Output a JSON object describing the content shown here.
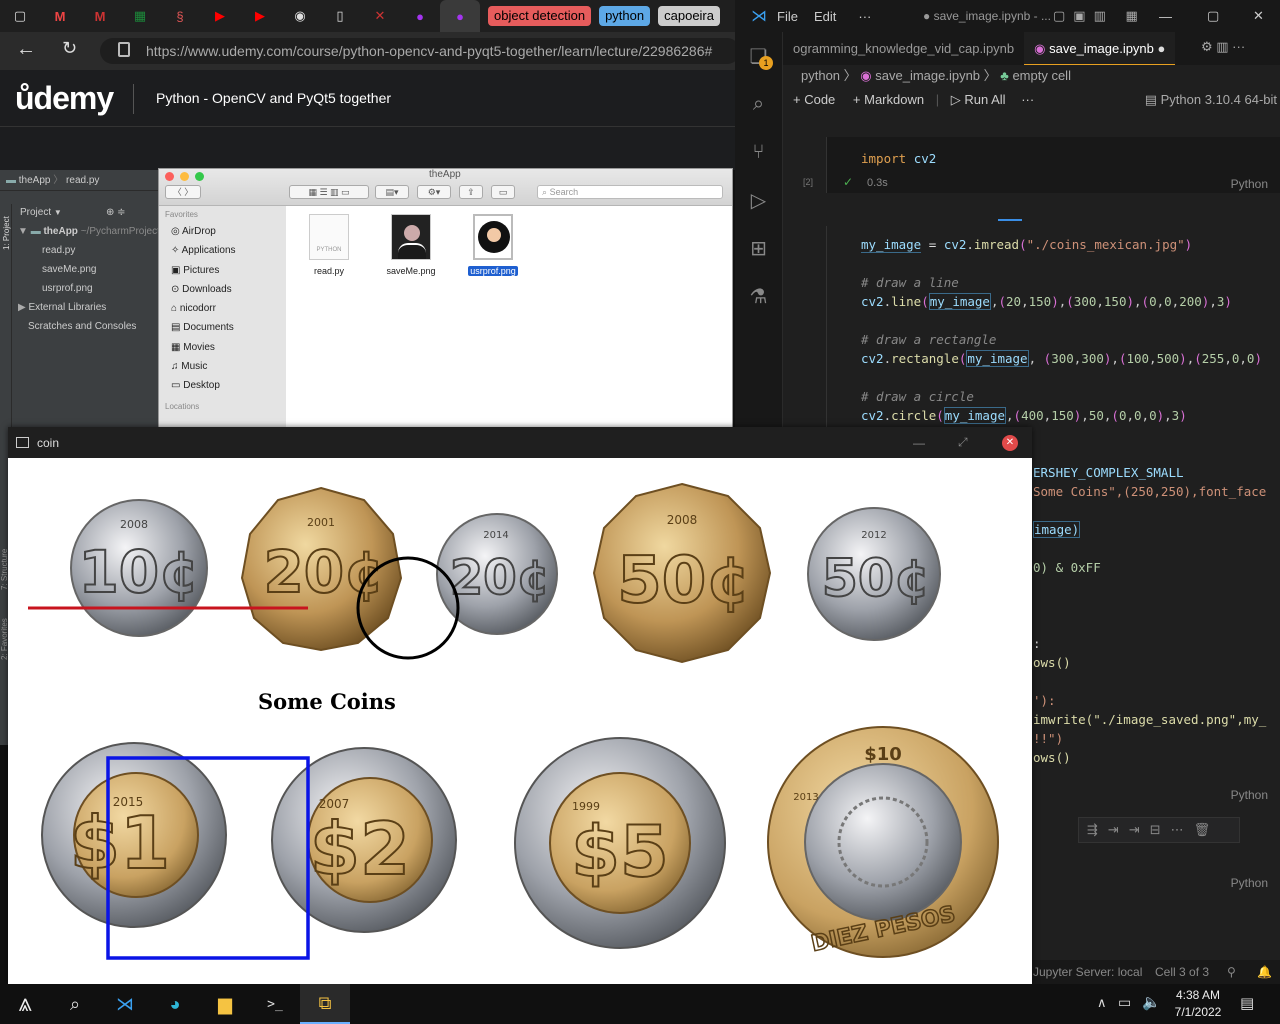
{
  "browser": {
    "bookmarks": [
      {
        "label": "object detection",
        "color": "#e65c5c"
      },
      {
        "label": "python",
        "color": "#5da8e6"
      },
      {
        "label": "capoeira",
        "color": "#cccccc"
      }
    ],
    "url": "https://www.udemy.com/course/python-opencv-and-pyqt5-together/learn/lecture/22986286#",
    "url_host": "www.udemy.com",
    "back_icon": "arrow-left-icon",
    "reload_icon": "reload-icon",
    "lock_icon": "lock-icon"
  },
  "udemy": {
    "logo": "ůdemy",
    "course_title": "Python - OpenCV and PyQt5 together"
  },
  "pycharm": {
    "breadcrumb_app": "theApp",
    "breadcrumb_file": "read.py",
    "panel_title": "Project",
    "side_tab_project": "1: Project",
    "side_tab_structure": "7: Structure",
    "side_tab_favorites": "2: Favorites",
    "tree": [
      {
        "label": "theApp",
        "detail": "~/PycharmProject",
        "indent": 0
      },
      {
        "label": "read.py",
        "indent": 2
      },
      {
        "label": "saveMe.png",
        "indent": 2
      },
      {
        "label": "usrprof.png",
        "indent": 2
      },
      {
        "label": "External Libraries",
        "indent": 1
      },
      {
        "label": "Scratches and Consoles",
        "indent": 1
      }
    ]
  },
  "finder": {
    "title": "theApp",
    "search_placeholder": "Search",
    "favorites_header": "Favorites",
    "favorites": [
      "AirDrop",
      "Applications",
      "Pictures",
      "Downloads",
      "nicodorr",
      "Documents",
      "Movies",
      "Music",
      "Desktop"
    ],
    "locations_header": "Locations",
    "files": [
      {
        "name": "read.py",
        "kind": "PYTHON"
      },
      {
        "name": "saveMe.png"
      },
      {
        "name": "usrprof.png",
        "selected": true
      }
    ]
  },
  "vscode": {
    "menu": [
      "File",
      "Edit",
      "···"
    ],
    "window_title": "● save_image.ipynb - ...",
    "explorer_badge": "1",
    "tabs": [
      {
        "label": "ogramming_knowledge_vid_cap.ipynb"
      },
      {
        "label": "save_image.ipynb",
        "active": true
      }
    ],
    "breadcrumb": [
      "python",
      "save_image.ipynb",
      "empty cell"
    ],
    "toolbar": {
      "code": "+ Code",
      "markdown": "+ Markdown",
      "run_all": "Run All",
      "more": "···",
      "kernel": "Python 3.10.4 64-bit"
    },
    "cell1": {
      "exec_count": "[2]",
      "time": "0.3s",
      "lang": "Python"
    },
    "cell2_lang": "Python",
    "cell3_lang": "Python",
    "status": {
      "jupyter": "Jupyter Server: local",
      "cell": "Cell 3 of 3"
    },
    "code_lines_visible": {
      "l1": "import cv2",
      "l2": "my_image = cv2.imread(\"./coins_mexican.jpg\")",
      "l3": "# draw a line",
      "l4": "cv2.line(my_image,(20,150),(300,150),(0,0,200),3)",
      "l5": "# draw a rectangle",
      "l6": "cv2.rectangle(my_image, (300,300),(100,500),(255,0,0)",
      "l7": "# draw a circle",
      "l8": "cv2.circle(my_image,(400,150),50,(0,0,0),3)",
      "l9": "ERSHEY_COMPLEX_SMALL",
      "l10": "Some Coins\",(250,250),font_face",
      "l11": "image)",
      "l12": "0) & 0xFF",
      "l13": ":",
      "l14": "ows()",
      "l15": "'):",
      "l16": "imwrite(\"./image_saved.png\",my_",
      "l17": "!!\")",
      "l18": "ows()"
    }
  },
  "coin_window": {
    "title": "coin",
    "overlay_text": "Some Coins",
    "coins": [
      {
        "value": "10¢",
        "year": "2008",
        "type": "silver"
      },
      {
        "value": "20¢",
        "year": "2001",
        "type": "gold"
      },
      {
        "value": "20¢",
        "year": "2014",
        "type": "silver"
      },
      {
        "value": "50¢",
        "year": "2008",
        "type": "gold"
      },
      {
        "value": "50¢",
        "year": "2012",
        "type": "silver"
      },
      {
        "value": "$1",
        "year": "2015",
        "type": "bimetal"
      },
      {
        "value": "$2",
        "year": "2007",
        "type": "bimetal"
      },
      {
        "value": "$5",
        "year": "1999",
        "type": "bimetal"
      },
      {
        "value": "$10",
        "year": "2013",
        "type": "bimetal-large",
        "text": "DIEZ PESOS"
      }
    ],
    "colors": {
      "line": "#c8141e",
      "rectangle": "#0a14e6",
      "circle": "#000000"
    }
  },
  "taskbar": {
    "time": "4:38 AM",
    "date": "7/1/2022"
  }
}
